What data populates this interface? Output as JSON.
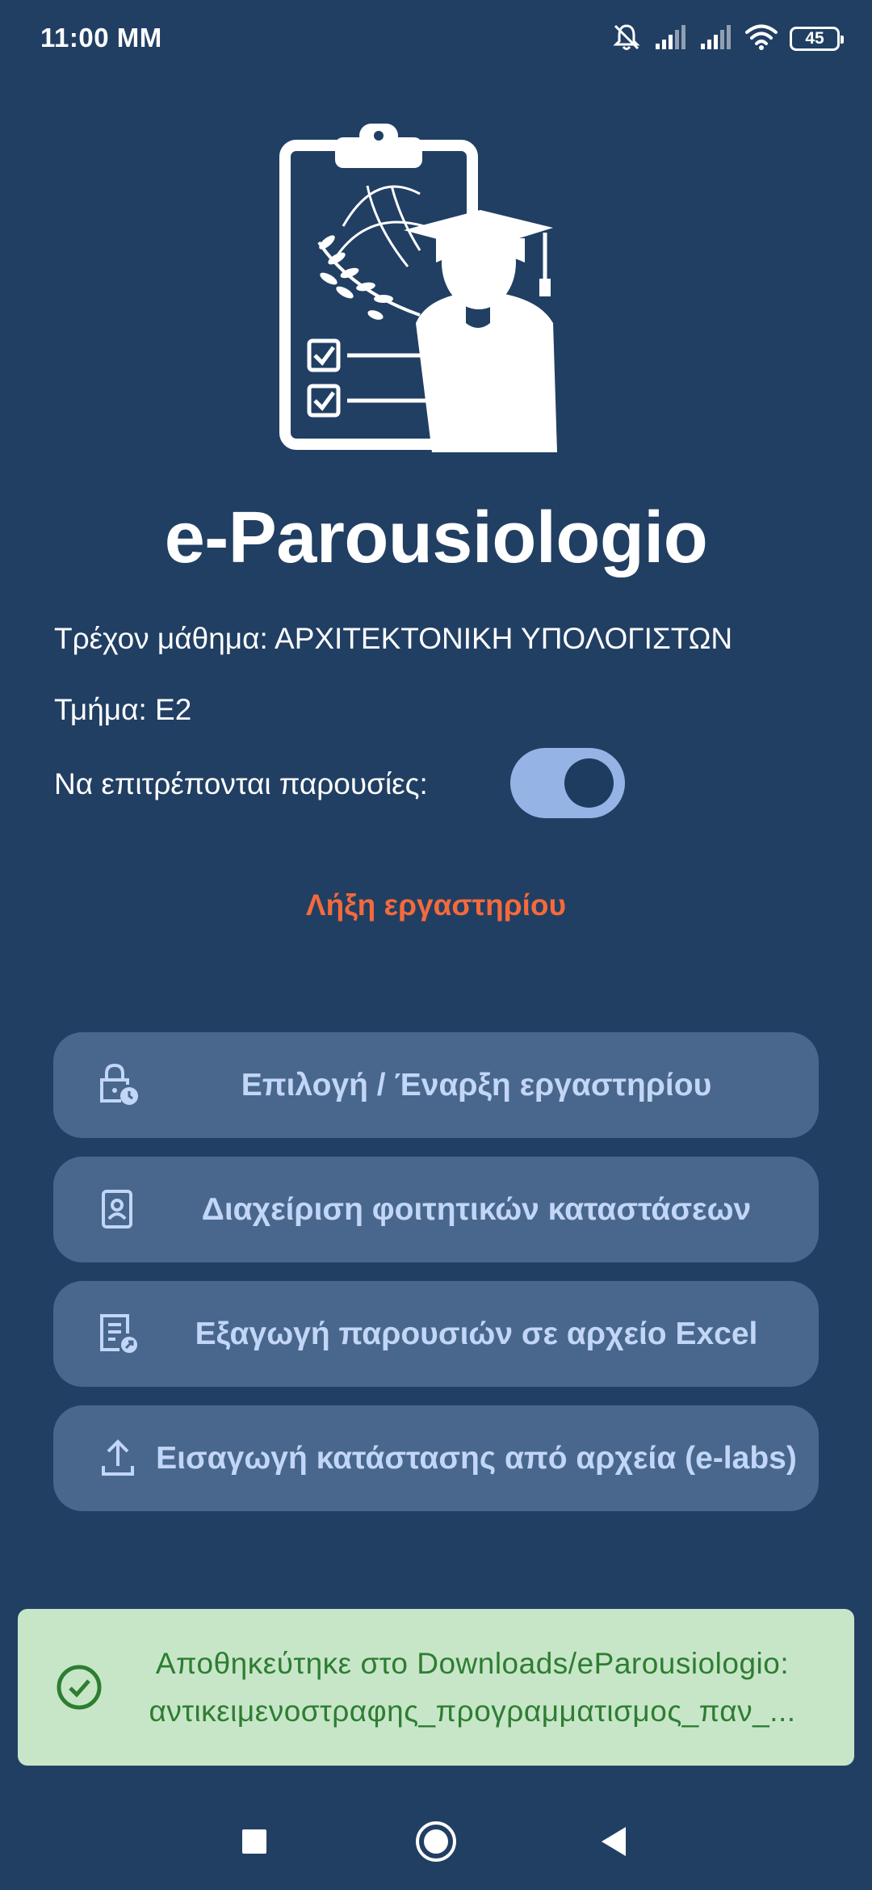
{
  "status_bar": {
    "time": "11:00 ΜΜ",
    "battery_level": "45",
    "icons": [
      "mute-icon",
      "signal-icon",
      "signal-icon",
      "wifi-icon",
      "battery-icon"
    ]
  },
  "app": {
    "title": "e-Parousiologio",
    "logo": "clipboard-graduate-logo"
  },
  "info": {
    "current_course": "Τρέχον μάθημα: ΑΡΧΙΤΕΚΤΟΝΙΚΗ ΥΠΟΛΟΓΙΣΤΩΝ",
    "department": "Τμήμα: Ε2",
    "allow_attendance_label": "Να επιτρέπονται παρουσίες:",
    "allow_attendance_on": true
  },
  "end_lab_label": "Λήξη εργαστηρίου",
  "actions": [
    {
      "label": "Επιλογή / Έναρξη εργαστηρίου",
      "icon": "lock-clock-icon"
    },
    {
      "label": "Διαχείριση φοιτητικών καταστάσεων",
      "icon": "student-card-icon"
    },
    {
      "label": "Εξαγωγή παρουσιών σε αρχείο Excel",
      "icon": "document-export-icon"
    },
    {
      "label": "Εισαγωγή κατάστασης από αρχεία (e-labs)",
      "icon": "upload-icon"
    }
  ],
  "snackbar": {
    "line1": "Αποθηκεύτηκε στο Downloads/eParousiologio:",
    "line2": "αντικειμενοστραφης_προγραμματισμος_παν_...",
    "icon": "check-circle-icon"
  },
  "nav": [
    "recents-square-icon",
    "home-circle-icon",
    "back-triangle-icon"
  ],
  "colors": {
    "background": "#213f63",
    "button": "#49678c",
    "button_text": "#c2d6f7",
    "accent_end": "#f46a3c",
    "toggle_track": "#96b3e6",
    "snackbar_bg": "#c7e6c8",
    "snackbar_text": "#2e7d32"
  }
}
